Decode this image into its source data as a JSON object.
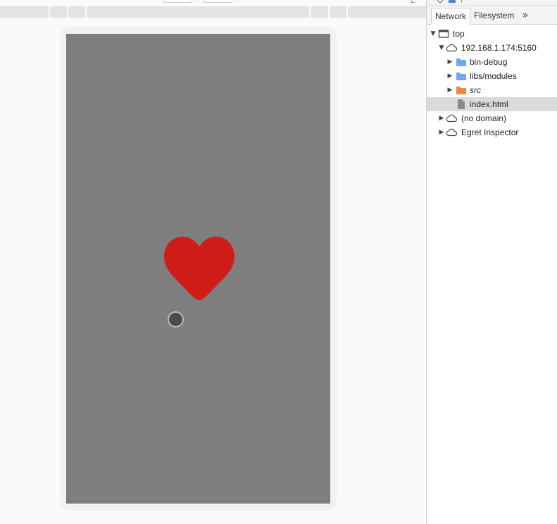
{
  "devtools": {
    "tabs": [
      {
        "label": "Network",
        "active": true
      },
      {
        "label": "Filesystem",
        "active": false
      }
    ],
    "more_tabs_icon": "»",
    "tree": [
      {
        "label": "top",
        "icon": "frame-icon",
        "expanded": true
      },
      {
        "label": "192.168.1.174:5160",
        "icon": "cloud-icon",
        "expanded": true
      },
      {
        "label": "bin-debug",
        "icon": "folder-icon",
        "color": "#6fa9ec",
        "expanded": false
      },
      {
        "label": "libs/modules",
        "icon": "folder-icon",
        "color": "#6fa9ec",
        "expanded": false
      },
      {
        "label": "src",
        "icon": "folder-icon",
        "color": "#e8894a",
        "expanded": false,
        "italic": true
      },
      {
        "label": "index.html",
        "icon": "file-icon",
        "selected": true
      },
      {
        "label": "(no domain)",
        "icon": "cloud-icon",
        "expanded": false
      },
      {
        "label": "Egret Inspector",
        "icon": "cloud-icon",
        "expanded": false
      }
    ]
  },
  "viewport": {
    "background": "#7d7e7d",
    "heart_color": "#cf1c19",
    "heart_icon": "heart-icon",
    "touch_indicator_icon": "touch-dot-icon"
  }
}
